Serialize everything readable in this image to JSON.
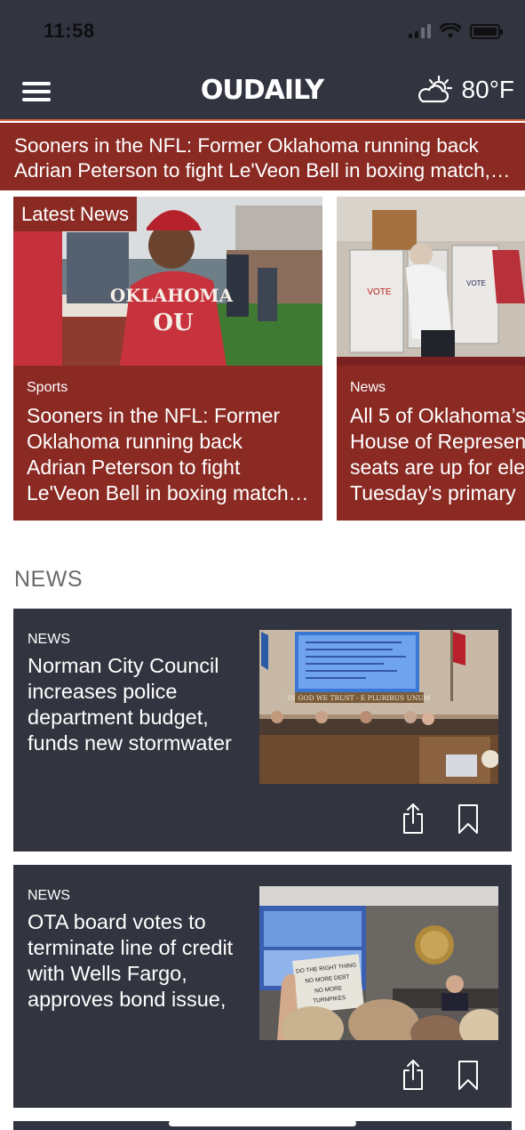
{
  "status_bar": {
    "time": "11:58"
  },
  "header": {
    "logo": "OUDAILY",
    "weather_temp": "80°F",
    "weather_icon": "partly-sunny-icon",
    "menu_icon": "hamburger-menu-icon"
  },
  "banner": {
    "line1": "Sooners in the NFL: Former Oklahoma running back",
    "line2": "Adrian Peterson to fight Le'Veon Bell in boxing match, p..."
  },
  "carousel": {
    "label": "Latest News",
    "cards": [
      {
        "section": "Sports",
        "title_lines": [
          "Sooners in the NFL: Former",
          "Oklahoma running back",
          "Adrian Peterson to fight",
          "Le'Veon Bell in boxing match…"
        ],
        "image_text": "OKLAHOMA"
      },
      {
        "section": "News",
        "title_lines": [
          "All 5 of Oklahoma’s",
          "House of Represen",
          "seats are up for ele",
          "Tuesday’s primary"
        ],
        "image_text": "VOTE"
      }
    ]
  },
  "news_section": {
    "title": "NEWS",
    "items": [
      {
        "category": "NEWS",
        "title_lines": [
          "Norman City Council",
          "increases police",
          "department budget,",
          "funds new stormwater"
        ],
        "image_text": "IN GOD WE TRUST · E PLURIBUS UNUM"
      },
      {
        "category": "NEWS",
        "title_lines": [
          "OTA board votes to",
          "terminate line of credit",
          "with Wells Fargo,",
          "approves bond issue,"
        ],
        "image_sign_lines": [
          "DO THE RIGHT THING",
          "NO MORE DEBT",
          "NO MORE",
          "TURNPIKES"
        ]
      }
    ]
  },
  "colors": {
    "header_bg": "#32343f",
    "brand_red": "#8a2a23",
    "accent_line": "#d0643f",
    "section_gray": "#6a6a6a"
  }
}
